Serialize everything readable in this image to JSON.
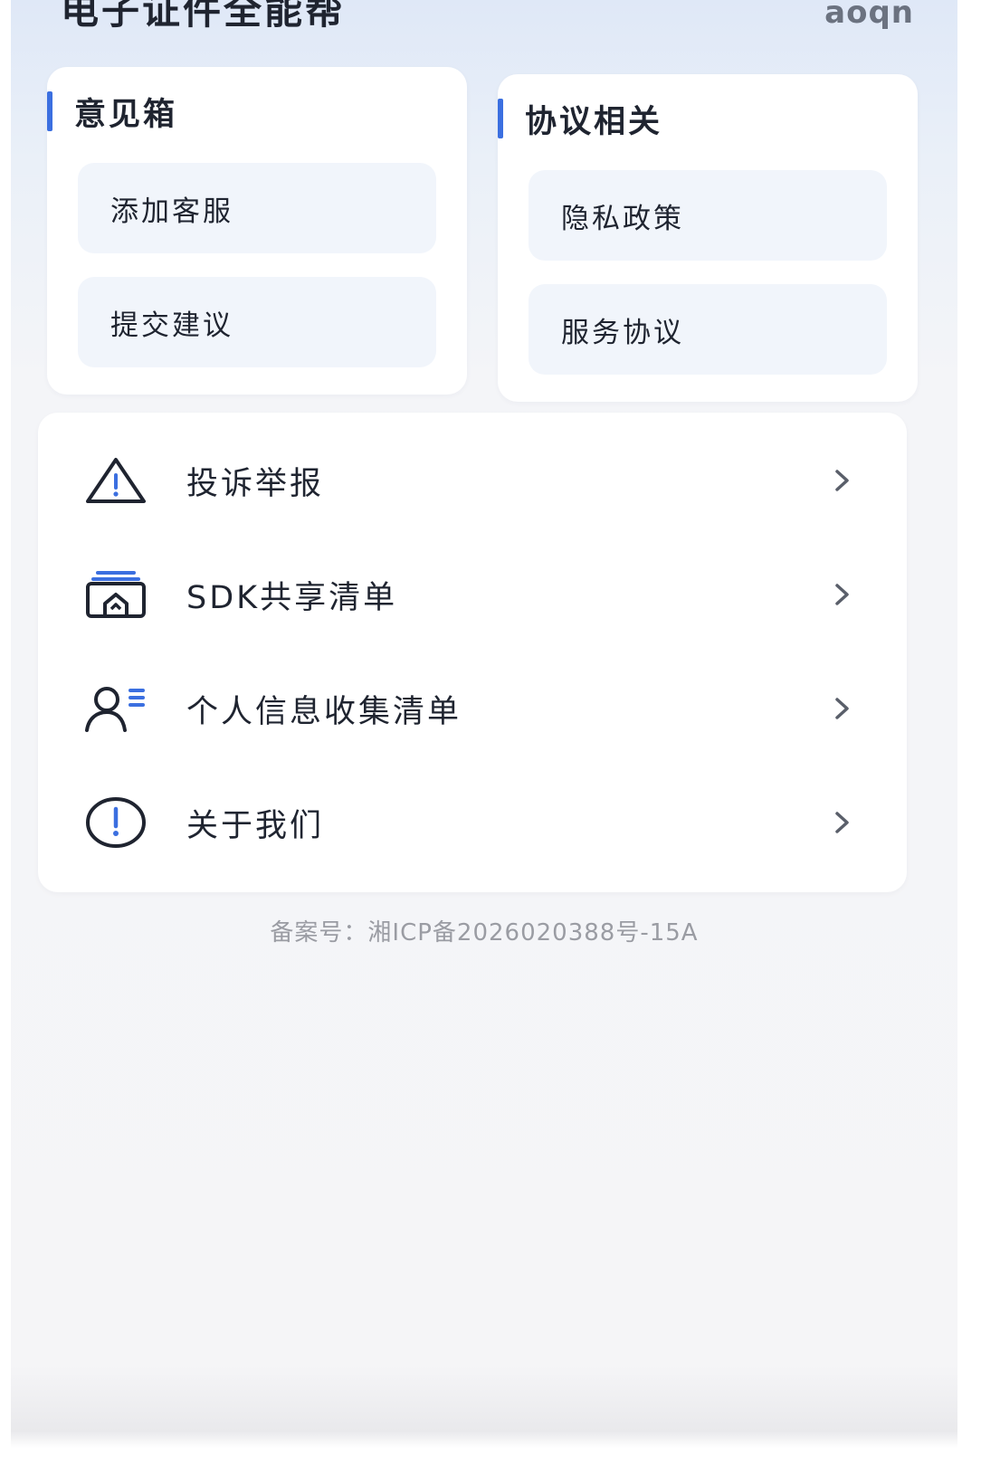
{
  "header": {
    "app_title": "电子证件全能帮",
    "user_name": "aoqn"
  },
  "feedback": {
    "title": "意见箱",
    "items": [
      {
        "label": "添加客服"
      },
      {
        "label": "提交建议"
      }
    ]
  },
  "agreement": {
    "title": "协议相关",
    "items": [
      {
        "label": "隐私政策"
      },
      {
        "label": "服务协议"
      }
    ]
  },
  "menu": {
    "items": [
      {
        "label": "投诉举报",
        "icon": "warning-icon"
      },
      {
        "label": "SDK共享清单",
        "icon": "share-list-icon"
      },
      {
        "label": "个人信息收集清单",
        "icon": "user-list-icon"
      },
      {
        "label": "关于我们",
        "icon": "info-icon"
      }
    ]
  },
  "footer": {
    "icp": "备案号：湘ICP备2026020388号-15A"
  },
  "colors": {
    "accent": "#3b6fe0",
    "text": "#1f2430",
    "muted": "#9a9ca3"
  }
}
